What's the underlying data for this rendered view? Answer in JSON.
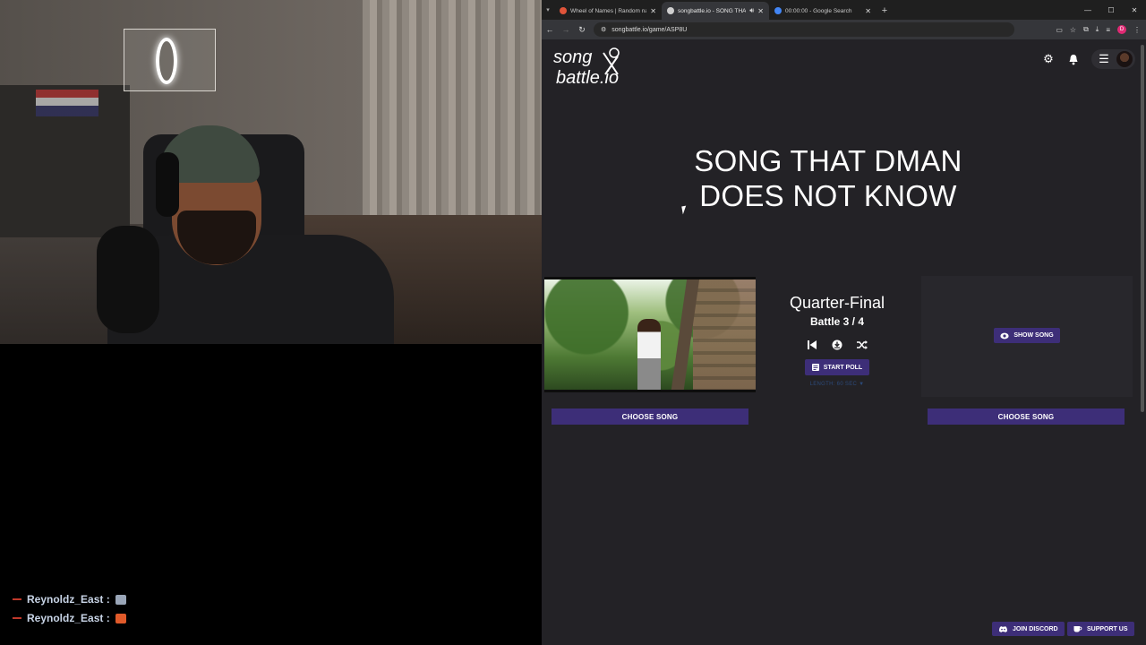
{
  "browser": {
    "tabs": [
      {
        "title": "Wheel of Names | Random nam",
        "active": false,
        "favicon_color": "#e0543a"
      },
      {
        "title": "songbattle.io - SONG THAT",
        "active": true,
        "favicon_color": "#cfcfcf",
        "audio": true
      },
      {
        "title": "00:00:00 - Google Search",
        "active": false,
        "favicon_color": "#4285f4"
      }
    ],
    "url": "songbattle.io/game/ASP8U",
    "profile_initial": "D"
  },
  "site": {
    "logo_line1": "song",
    "logo_line2": "battle.io"
  },
  "game": {
    "title": "SONG THAT DMAN DOES NOT KNOW",
    "round": "Quarter-Final",
    "battle": "Battle 3 / 4",
    "start_poll_label": "START POLL",
    "length_label": "LENGTH: 60 SEC",
    "show_song_label": "SHOW SONG",
    "choose_song_left": "CHOOSE SONG",
    "choose_song_right": "CHOOSE SONG"
  },
  "footer": {
    "join_discord": "JOIN DISCORD",
    "support_us": "SUPPORT US"
  },
  "chat": {
    "messages": [
      {
        "user": "Reynoldz_East :",
        "emote_color": "#9aa6b8"
      },
      {
        "user": "Reynoldz_East :",
        "emote_color": "#e05a2a"
      }
    ]
  },
  "colors": {
    "accent": "#3d2e78",
    "page_bg": "#232226"
  }
}
